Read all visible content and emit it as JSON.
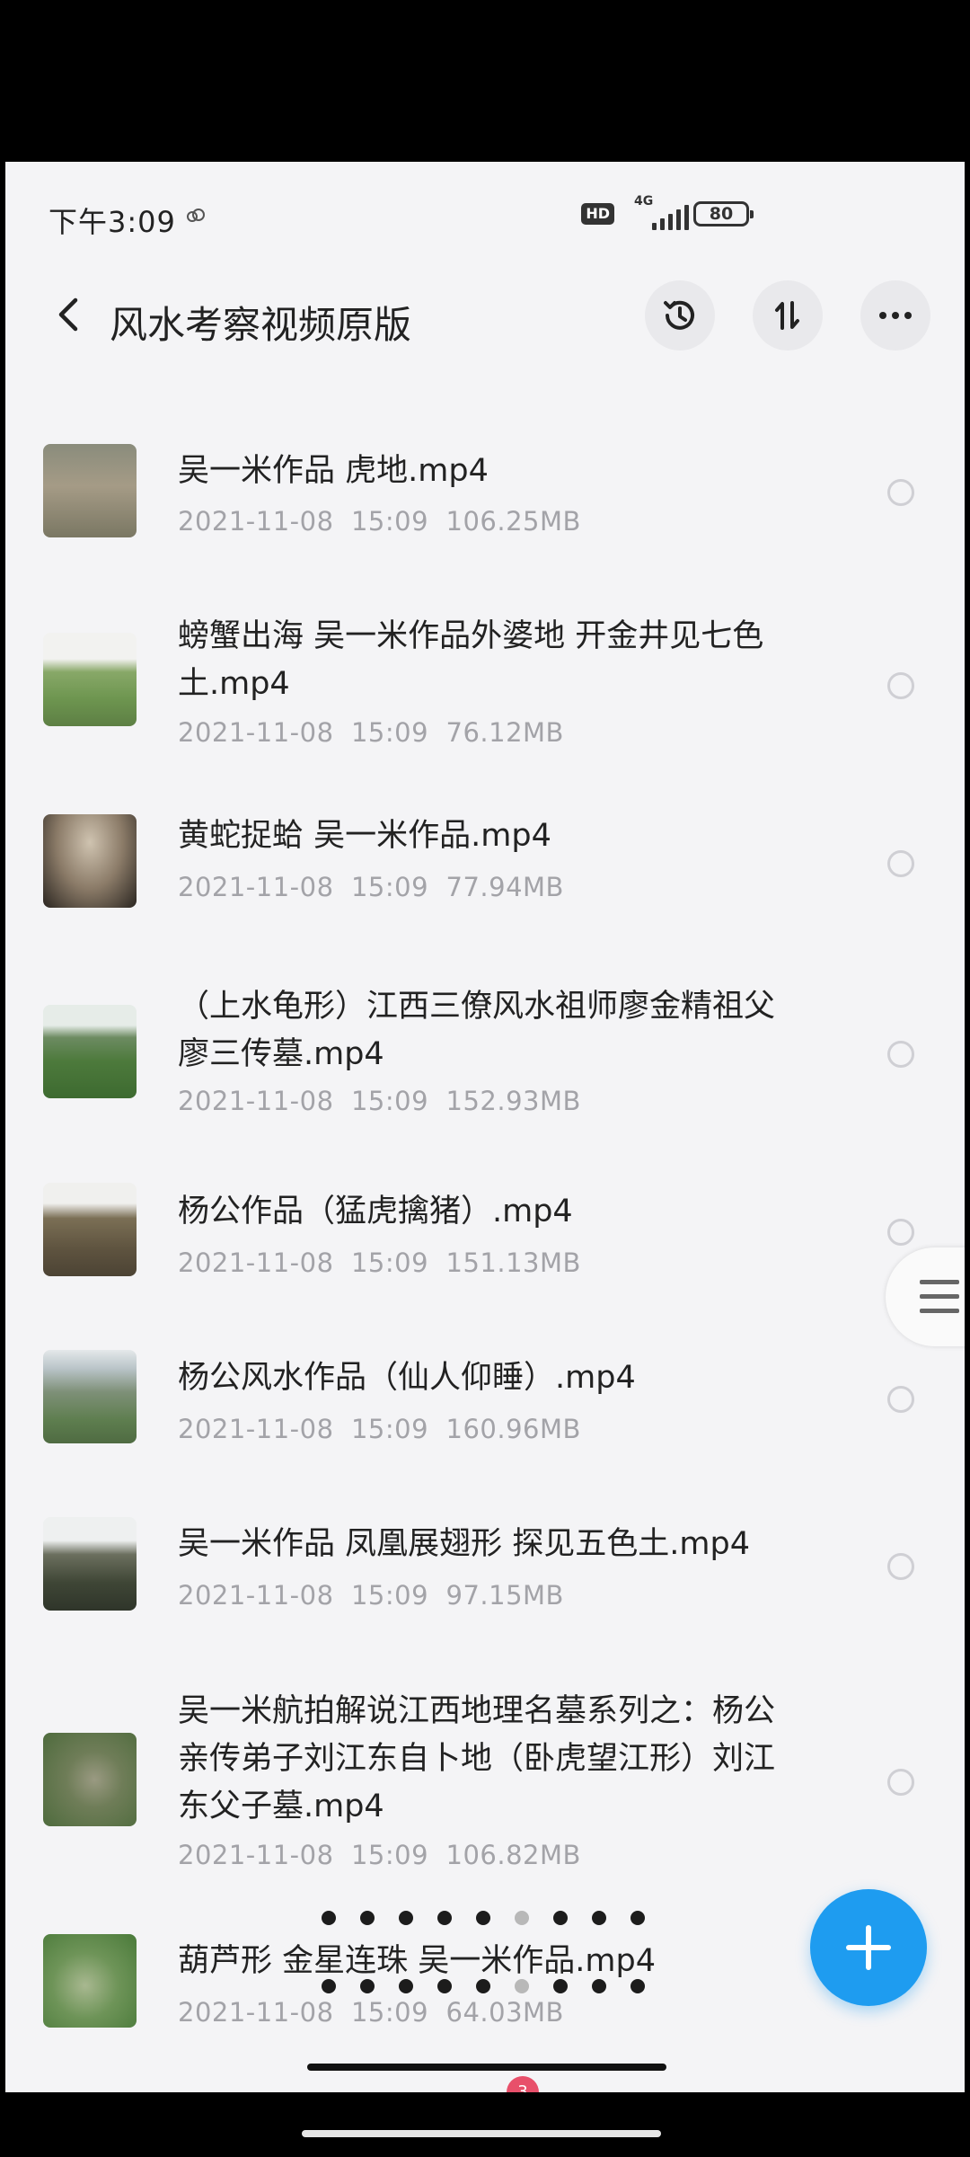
{
  "status_bar": {
    "time": "下午3:09",
    "hd_label": "HD",
    "network_label": "4G",
    "battery_level": "80"
  },
  "header": {
    "title": "风水考察视频原版",
    "icons": [
      "back-arrow-icon",
      "history-icon",
      "sort-icon",
      "more-icon"
    ]
  },
  "files": [
    {
      "name": "吴一米作品 虎地.mp4",
      "date": "2021-11-08",
      "time": "15:09",
      "size": "106.25MB"
    },
    {
      "name_lines": [
        "螃蟹出海 吴一米作品外婆地 开金井见七色",
        "土.mp4"
      ],
      "date": "2021-11-08",
      "time": "15:09",
      "size": "76.12MB"
    },
    {
      "name": "黄蛇捉蛤 吴一米作品.mp4",
      "date": "2021-11-08",
      "time": "15:09",
      "size": "77.94MB"
    },
    {
      "name_lines": [
        "（上水龟形）江西三僚风水祖师廖金精祖父",
        "廖三传墓.mp4"
      ],
      "date": "2021-11-08",
      "time": "15:09",
      "size": "152.93MB"
    },
    {
      "name": "杨公作品（猛虎擒猪）.mp4",
      "date": "2021-11-08",
      "time": "15:09",
      "size": "151.13MB"
    },
    {
      "name": "杨公风水作品（仙人仰睡）.mp4",
      "date": "2021-11-08",
      "time": "15:09",
      "size": "160.96MB"
    },
    {
      "name": "吴一米作品 凤凰展翅形 探见五色土.mp4",
      "date": "2021-11-08",
      "time": "15:09",
      "size": "97.15MB"
    },
    {
      "name_lines": [
        "吴一米航拍解说江西地理名墓系列之：杨公",
        "亲传弟子刘江东自卜地（卧虎望江形）刘江",
        "东父子墓.mp4"
      ],
      "date": "2021-11-08",
      "time": "15:09",
      "size": "106.82MB"
    },
    {
      "name": "葫芦形 金星连珠 吴一米作品.mp4",
      "date": "2021-11-08",
      "time": "15:09",
      "size": "64.03MB"
    }
  ],
  "fab": {
    "icon": "plus-icon"
  },
  "bottom_badge": "3",
  "colors": {
    "accent": "#1e9cf0",
    "meta_text": "#a3a3a8",
    "background": "#f4f4f6"
  }
}
